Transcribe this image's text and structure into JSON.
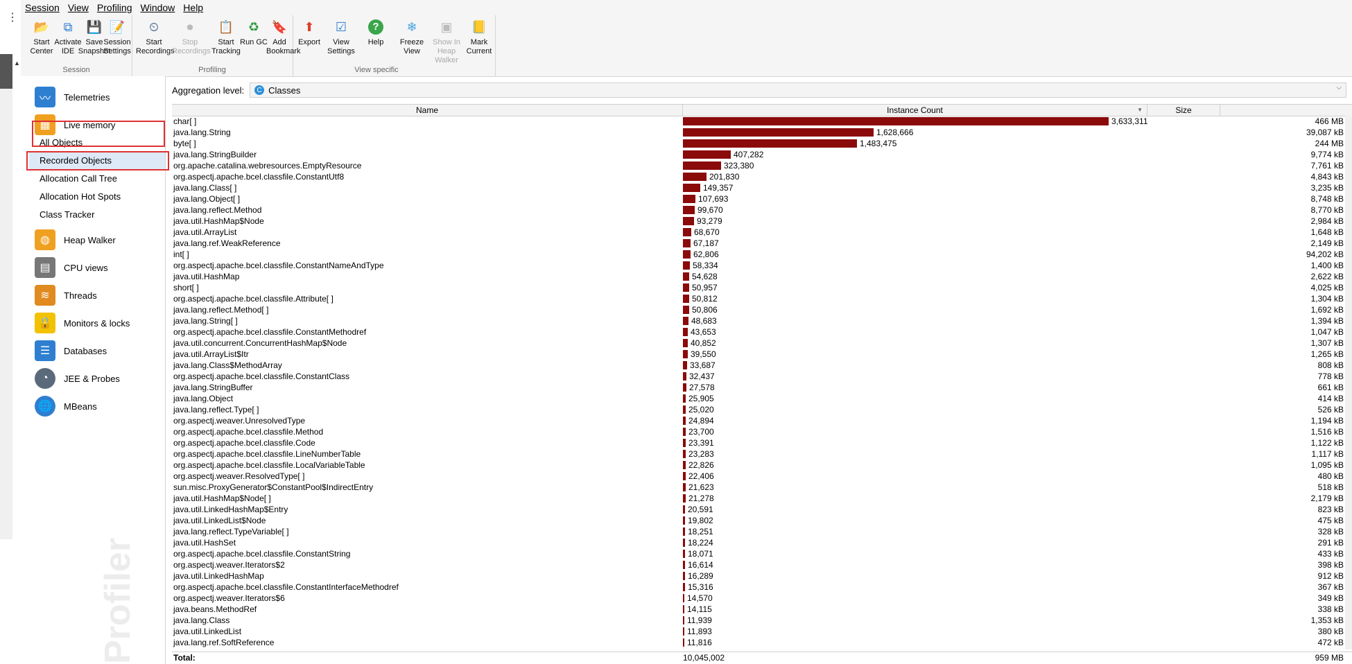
{
  "menu": [
    "Session",
    "View",
    "Profiling",
    "Window",
    "Help"
  ],
  "toolbar": {
    "session": {
      "caption": "Session",
      "buttons": [
        {
          "label": "Start\nCenter",
          "icon": "folder-star-icon"
        },
        {
          "label": "Activate\nIDE",
          "icon": "ide-icon"
        },
        {
          "label": "Save\nSnapshot",
          "icon": "save-icon"
        },
        {
          "label": "Session\nSettings",
          "icon": "settings-icon"
        }
      ]
    },
    "profiling": {
      "caption": "Profiling",
      "buttons": [
        {
          "label": "Start\nRecordings",
          "icon": "gauge-icon",
          "disabled": false
        },
        {
          "label": "Stop\nRecordings",
          "icon": "stop-icon",
          "disabled": true
        },
        {
          "label": "Start\nTracking",
          "icon": "tracking-icon",
          "disabled": false
        },
        {
          "label": "Run GC",
          "icon": "recycle-icon",
          "disabled": false
        },
        {
          "label": "Add\nBookmark",
          "icon": "bookmark-icon",
          "disabled": false
        }
      ]
    },
    "view": {
      "caption": "View specific",
      "buttons": [
        {
          "label": "Export",
          "icon": "export-icon",
          "disabled": false
        },
        {
          "label": "View\nSettings",
          "icon": "view-settings-icon",
          "disabled": false
        },
        {
          "label": "Help",
          "icon": "help-icon",
          "disabled": false
        },
        {
          "label": "Freeze\nView",
          "icon": "snowflake-icon",
          "disabled": false
        },
        {
          "label": "Show In\nHeap Walker",
          "icon": "heap-walker-icon",
          "disabled": true
        },
        {
          "label": "Mark\nCurrent",
          "icon": "mark-icon",
          "disabled": false
        }
      ]
    }
  },
  "sidebar": {
    "items": [
      {
        "label": "Telemetries",
        "icon": "telemetry-icon",
        "color": "#2f7fd1"
      },
      {
        "label": "Live memory",
        "icon": "memory-icon",
        "color": "#f0a020"
      },
      {
        "label": "Heap Walker",
        "icon": "heap-walker-icon",
        "color": "#f0a020"
      },
      {
        "label": "CPU views",
        "icon": "cpu-icon",
        "color": "#777777"
      },
      {
        "label": "Threads",
        "icon": "threads-icon",
        "color": "#e08a20"
      },
      {
        "label": "Monitors & locks",
        "icon": "lock-icon",
        "color": "#f2c200"
      },
      {
        "label": "Databases",
        "icon": "database-icon",
        "color": "#2f7fd1"
      },
      {
        "label": "JEE & Probes",
        "icon": "probe-icon",
        "color": "#5a6a7a"
      },
      {
        "label": "MBeans",
        "icon": "globe-icon",
        "color": "#2f7fd1"
      }
    ],
    "subitems": [
      "All Objects",
      "Recorded Objects",
      "Allocation Call Tree",
      "Allocation Hot Spots",
      "Class Tracker"
    ],
    "selected_subitem": "All Objects",
    "watermark": "Profiler"
  },
  "aggregation": {
    "label": "Aggregation level:",
    "value": "Classes",
    "icon": "class-icon"
  },
  "table": {
    "headers": [
      "Name",
      "Instance Count",
      "Size"
    ],
    "max_count": 3633311,
    "rows": [
      {
        "name": "char[ ]",
        "count": 3633311,
        "count_text": "3,633,311",
        "size": "466 MB"
      },
      {
        "name": "java.lang.String",
        "count": 1628666,
        "count_text": "1,628,666",
        "size": "39,087 kB"
      },
      {
        "name": "byte[ ]",
        "count": 1483475,
        "count_text": "1,483,475",
        "size": "244 MB"
      },
      {
        "name": "java.lang.StringBuilder",
        "count": 407282,
        "count_text": "407,282",
        "size": "9,774 kB"
      },
      {
        "name": "org.apache.catalina.webresources.EmptyResource",
        "count": 323380,
        "count_text": "323,380",
        "size": "7,761 kB"
      },
      {
        "name": "org.aspectj.apache.bcel.classfile.ConstantUtf8",
        "count": 201830,
        "count_text": "201,830",
        "size": "4,843 kB"
      },
      {
        "name": "java.lang.Class[ ]",
        "count": 149357,
        "count_text": "149,357",
        "size": "3,235 kB"
      },
      {
        "name": "java.lang.Object[ ]",
        "count": 107693,
        "count_text": "107,693",
        "size": "8,748 kB"
      },
      {
        "name": "java.lang.reflect.Method",
        "count": 99670,
        "count_text": "99,670",
        "size": "8,770 kB"
      },
      {
        "name": "java.util.HashMap$Node",
        "count": 93279,
        "count_text": "93,279",
        "size": "2,984 kB"
      },
      {
        "name": "java.util.ArrayList",
        "count": 68670,
        "count_text": "68,670",
        "size": "1,648 kB"
      },
      {
        "name": "java.lang.ref.WeakReference",
        "count": 67187,
        "count_text": "67,187",
        "size": "2,149 kB"
      },
      {
        "name": "int[ ]",
        "count": 62806,
        "count_text": "62,806",
        "size": "94,202 kB"
      },
      {
        "name": "org.aspectj.apache.bcel.classfile.ConstantNameAndType",
        "count": 58334,
        "count_text": "58,334",
        "size": "1,400 kB"
      },
      {
        "name": "java.util.HashMap",
        "count": 54628,
        "count_text": "54,628",
        "size": "2,622 kB"
      },
      {
        "name": "short[ ]",
        "count": 50957,
        "count_text": "50,957",
        "size": "4,025 kB"
      },
      {
        "name": "org.aspectj.apache.bcel.classfile.Attribute[ ]",
        "count": 50812,
        "count_text": "50,812",
        "size": "1,304 kB"
      },
      {
        "name": "java.lang.reflect.Method[ ]",
        "count": 50806,
        "count_text": "50,806",
        "size": "1,692 kB"
      },
      {
        "name": "java.lang.String[ ]",
        "count": 48683,
        "count_text": "48,683",
        "size": "1,394 kB"
      },
      {
        "name": "org.aspectj.apache.bcel.classfile.ConstantMethodref",
        "count": 43653,
        "count_text": "43,653",
        "size": "1,047 kB"
      },
      {
        "name": "java.util.concurrent.ConcurrentHashMap$Node",
        "count": 40852,
        "count_text": "40,852",
        "size": "1,307 kB"
      },
      {
        "name": "java.util.ArrayList$Itr",
        "count": 39550,
        "count_text": "39,550",
        "size": "1,265 kB"
      },
      {
        "name": "java.lang.Class$MethodArray",
        "count": 33687,
        "count_text": "33,687",
        "size": "808 kB"
      },
      {
        "name": "org.aspectj.apache.bcel.classfile.ConstantClass",
        "count": 32437,
        "count_text": "32,437",
        "size": "778 kB"
      },
      {
        "name": "java.lang.StringBuffer",
        "count": 27578,
        "count_text": "27,578",
        "size": "661 kB"
      },
      {
        "name": "java.lang.Object",
        "count": 25905,
        "count_text": "25,905",
        "size": "414 kB"
      },
      {
        "name": "java.lang.reflect.Type[ ]",
        "count": 25020,
        "count_text": "25,020",
        "size": "526 kB"
      },
      {
        "name": "org.aspectj.weaver.UnresolvedType",
        "count": 24894,
        "count_text": "24,894",
        "size": "1,194 kB"
      },
      {
        "name": "org.aspectj.apache.bcel.classfile.Method",
        "count": 23700,
        "count_text": "23,700",
        "size": "1,516 kB"
      },
      {
        "name": "org.aspectj.apache.bcel.classfile.Code",
        "count": 23391,
        "count_text": "23,391",
        "size": "1,122 kB"
      },
      {
        "name": "org.aspectj.apache.bcel.classfile.LineNumberTable",
        "count": 23283,
        "count_text": "23,283",
        "size": "1,117 kB"
      },
      {
        "name": "org.aspectj.apache.bcel.classfile.LocalVariableTable",
        "count": 22826,
        "count_text": "22,826",
        "size": "1,095 kB"
      },
      {
        "name": "org.aspectj.weaver.ResolvedType[ ]",
        "count": 22406,
        "count_text": "22,406",
        "size": "480 kB"
      },
      {
        "name": "sun.misc.ProxyGenerator$ConstantPool$IndirectEntry",
        "count": 21623,
        "count_text": "21,623",
        "size": "518 kB"
      },
      {
        "name": "java.util.HashMap$Node[ ]",
        "count": 21278,
        "count_text": "21,278",
        "size": "2,179 kB"
      },
      {
        "name": "java.util.LinkedHashMap$Entry",
        "count": 20591,
        "count_text": "20,591",
        "size": "823 kB"
      },
      {
        "name": "java.util.LinkedList$Node",
        "count": 19802,
        "count_text": "19,802",
        "size": "475 kB"
      },
      {
        "name": "java.lang.reflect.TypeVariable[ ]",
        "count": 18251,
        "count_text": "18,251",
        "size": "328 kB"
      },
      {
        "name": "java.util.HashSet",
        "count": 18224,
        "count_text": "18,224",
        "size": "291 kB"
      },
      {
        "name": "org.aspectj.apache.bcel.classfile.ConstantString",
        "count": 18071,
        "count_text": "18,071",
        "size": "433 kB"
      },
      {
        "name": "org.aspectj.weaver.Iterators$2",
        "count": 16614,
        "count_text": "16,614",
        "size": "398 kB"
      },
      {
        "name": "java.util.LinkedHashMap",
        "count": 16289,
        "count_text": "16,289",
        "size": "912 kB"
      },
      {
        "name": "org.aspectj.apache.bcel.classfile.ConstantInterfaceMethodref",
        "count": 15316,
        "count_text": "15,316",
        "size": "367 kB"
      },
      {
        "name": "org.aspectj.weaver.Iterators$6",
        "count": 14570,
        "count_text": "14,570",
        "size": "349 kB"
      },
      {
        "name": "java.beans.MethodRef",
        "count": 14115,
        "count_text": "14,115",
        "size": "338 kB"
      },
      {
        "name": "java.lang.Class",
        "count": 11939,
        "count_text": "11,939",
        "size": "1,353 kB"
      },
      {
        "name": "java.util.LinkedList",
        "count": 11893,
        "count_text": "11,893",
        "size": "380 kB"
      },
      {
        "name": "java.lang.ref.SoftReference",
        "count": 11816,
        "count_text": "11,816",
        "size": "472 kB"
      }
    ],
    "total": {
      "label": "Total:",
      "count": "10,045,002",
      "size": "959 MB"
    }
  },
  "colors": {
    "bar": "#8b0a0a",
    "highlight_box": "#e03030",
    "selection": "#dde9f7"
  }
}
